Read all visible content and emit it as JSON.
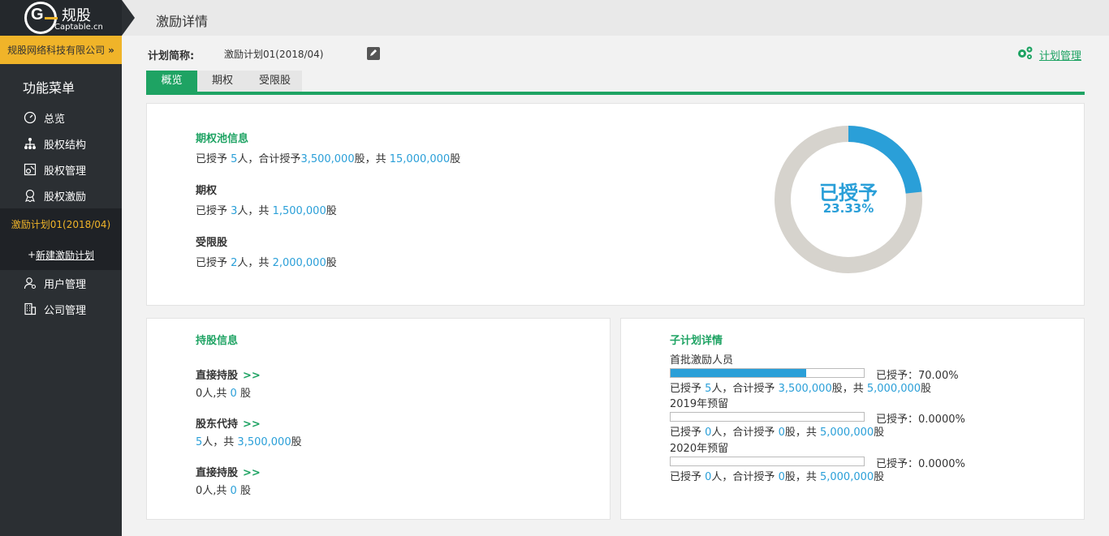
{
  "brand": {
    "name": "规股",
    "sub": "Captable.cn",
    "g": "G"
  },
  "company": {
    "name": "规股网络科技有限公司",
    "chevron": "»"
  },
  "menu": {
    "title": "功能菜单",
    "items": [
      {
        "label": "总览",
        "icon": "dashboard-icon"
      },
      {
        "label": "股权结构",
        "icon": "org-chart-icon"
      },
      {
        "label": "股权管理",
        "icon": "equity-mgmt-icon"
      },
      {
        "label": "股权激励",
        "icon": "award-icon"
      }
    ],
    "sub": {
      "active": "激励计划01(2018/04)",
      "new_prefix": "+ ",
      "new_label": "新建激励计划"
    },
    "items2": [
      {
        "label": "用户管理",
        "icon": "user-icon"
      },
      {
        "label": "公司管理",
        "icon": "building-icon"
      }
    ]
  },
  "header": {
    "title": "激励详情"
  },
  "plan": {
    "label": "计划简称:",
    "value": "激励计划01(2018/04)",
    "manage": "计划管理"
  },
  "tabs": [
    "概览",
    "期权",
    "受限股"
  ],
  "pool": {
    "title": "期权池信息",
    "line": {
      "p1": "已授予 ",
      "n1": "5",
      "p2": "人，合计授予",
      "n2": "3,500,000",
      "p3": "股，共 ",
      "n3": "15,000,000",
      "p4": "股"
    },
    "option": {
      "title": "期权",
      "p1": "已授予 ",
      "n1": "3",
      "p2": "人，共 ",
      "n2": "1,500,000",
      "p3": "股"
    },
    "restricted": {
      "title": "受限股",
      "p1": "已授予 ",
      "n1": "2",
      "p2": "人，共 ",
      "n2": "2,000,000",
      "p3": "股"
    },
    "donut": {
      "label": "已授予",
      "percent_text": "23.33%",
      "percent": 0.2333,
      "fill_color": "#2a9fd8",
      "track_color": "#d6d3cd"
    }
  },
  "holdings": {
    "title": "持股信息",
    "arrow": ">>",
    "rows": [
      {
        "title": "直接持股",
        "n1": "0",
        "p1": "人,共 ",
        "n2": "0",
        "p2": " 股"
      },
      {
        "title": "股东代持",
        "n1": "5",
        "p1": "人，共 ",
        "n2": "3,500,000",
        "p2": "股"
      },
      {
        "title": "直接持股",
        "n1": "0",
        "p1": "人,共 ",
        "n2": "0",
        "p2": " 股"
      }
    ]
  },
  "subplans": {
    "title": "子计划详情",
    "items": [
      {
        "name": "首批激励人员",
        "pct": "已授予：70.00%",
        "fill": 0.7,
        "p1": "已授予 ",
        "n1": "5",
        "p2": "人，合计授予 ",
        "n2": "3,500,000",
        "p3": "股，共 ",
        "n3": "5,000,000",
        "p4": "股"
      },
      {
        "name": "2019年预留",
        "pct": "已授予：0.0000%",
        "fill": 0,
        "p1": "已授予 ",
        "n1": "0",
        "p2": "人，合计授予 ",
        "n2": "0",
        "p3": "股，共 ",
        "n3": "5,000,000",
        "p4": "股"
      },
      {
        "name": "2020年预留",
        "pct": "已授予：0.0000%",
        "fill": 0,
        "p1": "已授予 ",
        "n1": "0",
        "p2": "人，合计授予 ",
        "n2": "0",
        "p3": "股，共 ",
        "n3": "5,000,000",
        "p4": "股"
      }
    ]
  }
}
